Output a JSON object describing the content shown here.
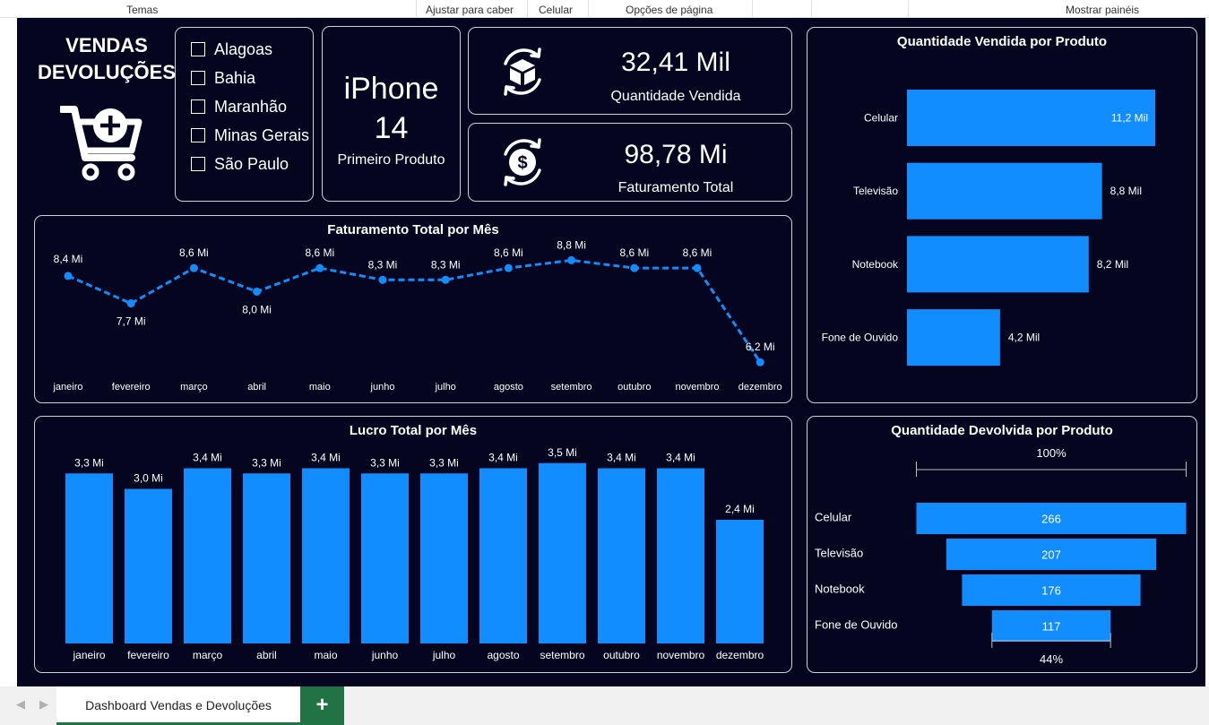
{
  "ribbon": {
    "labels": [
      "Temas",
      "Ajustar para caber",
      "Celular",
      "Opções de página",
      "Mostrar painéis"
    ]
  },
  "header": {
    "title_line1": "VENDAS",
    "title_line2": "DEVOLUÇÕES"
  },
  "filter": {
    "items": [
      "Alagoas",
      "Bahia",
      "Maranhão",
      "Minas Gerais",
      "São Paulo"
    ]
  },
  "first_product": {
    "name_line1": "iPhone",
    "name_line2": "14",
    "caption": "Primeiro Produto"
  },
  "kpis": {
    "quantity": {
      "value": "32,41 Mil",
      "label": "Quantidade Vendida",
      "icon": "box-icon"
    },
    "revenue": {
      "value": "98,78 Mi",
      "label": "Faturamento Total",
      "icon": "dollar-coin-icon"
    }
  },
  "colors": {
    "background": "#050520",
    "accent": "#118dff",
    "text": "#ffffff",
    "border": "#d0d0dc"
  },
  "chart_data": [
    {
      "type": "line",
      "title": "Faturamento Total por Mês",
      "categories": [
        "janeiro",
        "fevereiro",
        "março",
        "abril",
        "maio",
        "junho",
        "julho",
        "agosto",
        "setembro",
        "outubro",
        "novembro",
        "dezembro"
      ],
      "values": [
        8.4,
        7.7,
        8.6,
        8.0,
        8.6,
        8.3,
        8.3,
        8.6,
        8.8,
        8.6,
        8.6,
        6.2
      ],
      "labels": [
        "8,4 Mi",
        "7,7 Mi",
        "8,6 Mi",
        "8,0 Mi",
        "8,6 Mi",
        "8,3 Mi",
        "8,3 Mi",
        "8,6 Mi",
        "8,8 Mi",
        "8,6 Mi",
        "8,6 Mi",
        "6,2 Mi"
      ],
      "style": "dashed",
      "grid": false
    },
    {
      "type": "bar",
      "title": "Lucro Total por Mês",
      "categories": [
        "janeiro",
        "fevereiro",
        "março",
        "abril",
        "maio",
        "junho",
        "julho",
        "agosto",
        "setembro",
        "outubro",
        "novembro",
        "dezembro"
      ],
      "values": [
        3.3,
        3.0,
        3.4,
        3.3,
        3.4,
        3.3,
        3.3,
        3.4,
        3.5,
        3.4,
        3.4,
        2.4
      ],
      "labels": [
        "3,3 Mi",
        "3,0 Mi",
        "3,4 Mi",
        "3,3 Mi",
        "3,4 Mi",
        "3,3 Mi",
        "3,3 Mi",
        "3,4 Mi",
        "3,5 Mi",
        "3,4 Mi",
        "3,4 Mi",
        "2,4 Mi"
      ],
      "grid": false
    },
    {
      "type": "bar",
      "orientation": "horizontal",
      "title": "Quantidade Vendida por Produto",
      "categories": [
        "Celular",
        "Televisão",
        "Notebook",
        "Fone de Ouvido"
      ],
      "values": [
        11.2,
        8.8,
        8.2,
        4.2
      ],
      "labels": [
        "11,2 Mil",
        "8,8 Mil",
        "8,2 Mil",
        "4,2 Mil"
      ]
    },
    {
      "type": "bar",
      "orientation": "funnel",
      "title": "Quantidade Devolvida por Produto",
      "categories": [
        "Celular",
        "Televisão",
        "Notebook",
        "Fone de Ouvido"
      ],
      "values": [
        266,
        207,
        176,
        117
      ],
      "labels": [
        "266",
        "207",
        "176",
        "117"
      ],
      "top_percent": "100%",
      "bottom_percent": "44%"
    }
  ],
  "tabs": {
    "active": "Dashboard Vendas e Devoluções",
    "add_label": "+"
  }
}
